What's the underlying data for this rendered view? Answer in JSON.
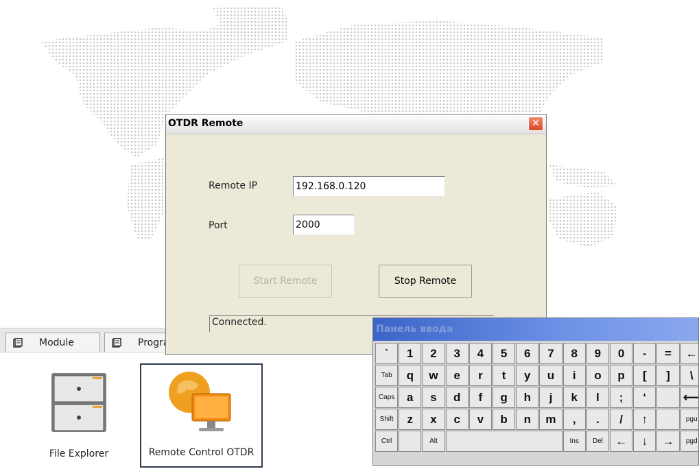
{
  "dialog": {
    "title": "OTDR Remote",
    "close_glyph": "✕",
    "remote_ip_label": "Remote IP",
    "remote_ip_value": "192.168.0.120",
    "port_label": "Port",
    "port_value": "2000",
    "start_button": "Start Remote",
    "stop_button": "Stop Remote",
    "status_text": "Connected."
  },
  "tabs": [
    {
      "label": "Module",
      "icon": "tab-icon"
    },
    {
      "label": "Progra",
      "icon": "tab-icon"
    }
  ],
  "programs": [
    {
      "label": "File Explorer",
      "icon": "file-cabinet-icon"
    },
    {
      "label": "Remote Control OTDR",
      "icon": "remote-monitor-icon"
    }
  ],
  "keyboard": {
    "title": "Панель ввода",
    "rows": [
      [
        "`",
        "1",
        "2",
        "3",
        "4",
        "5",
        "6",
        "7",
        "8",
        "9",
        "0",
        "-",
        "=",
        "←"
      ],
      [
        "Tab",
        "q",
        "w",
        "e",
        "r",
        "t",
        "y",
        "u",
        "i",
        "o",
        "p",
        "[",
        "]",
        "\\"
      ],
      [
        "Caps",
        "a",
        "s",
        "d",
        "f",
        "g",
        "h",
        "j",
        "k",
        "l",
        ";",
        "‘",
        "",
        "⟵"
      ],
      [
        "Shift",
        "z",
        "x",
        "c",
        "v",
        "b",
        "n",
        "m",
        ",",
        ".",
        "/",
        "↑",
        "",
        "pgu"
      ],
      [
        "Ctrl",
        "",
        "Alt",
        "",
        "",
        "",
        "",
        "",
        "Ins",
        "Del",
        "←",
        "↓",
        "→",
        "pgd"
      ]
    ]
  },
  "colors": {
    "dialog_bg": "#ece9d8",
    "keyboard_title": "#3a64c8",
    "close_button": "#d8462a",
    "map_dots": "#c8c8c8"
  }
}
